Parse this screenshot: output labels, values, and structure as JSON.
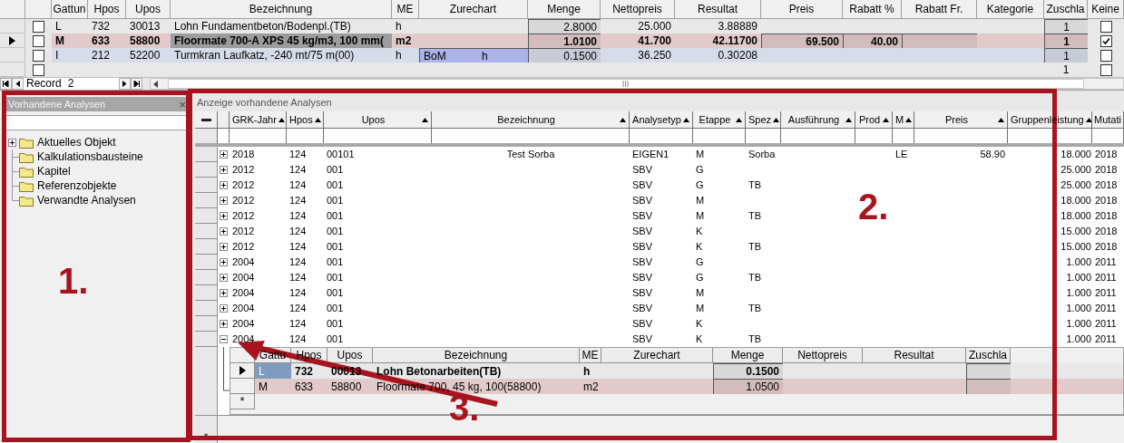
{
  "positions": {
    "columns": [
      {
        "label": "Gattun"
      },
      {
        "label": "Hpos"
      },
      {
        "label": "Upos"
      },
      {
        "label": "Bezeichnung"
      },
      {
        "label": "ME"
      },
      {
        "label": "Zurechart"
      },
      {
        "label": "Menge"
      },
      {
        "label": "Nettopreis"
      },
      {
        "label": "Resultat"
      },
      {
        "label": "Preis"
      },
      {
        "label": "Rabatt %"
      },
      {
        "label": "Rabatt Fr."
      },
      {
        "label": "Kategorie"
      },
      {
        "label": "Zuschla"
      },
      {
        "label": "Keine"
      }
    ],
    "rows": [
      {
        "selected": false,
        "checked": false,
        "keine_checked": false,
        "color": "#e8e8e8",
        "cells": [
          "L",
          "732",
          "30013",
          "Lohn Fundamentbeton/Bodenpl.(TB)",
          "h",
          null,
          "2.8000",
          "25.000",
          "3.88889",
          null,
          null,
          null,
          null,
          "1"
        ]
      },
      {
        "selected": true,
        "checked": false,
        "keine_checked": true,
        "color": "#e2caca",
        "cells": [
          "M",
          "633",
          "58800",
          "Floormate 700-A XPS 45 kg/m3, 100 mm(",
          "m2",
          null,
          "1.0100",
          "41.700",
          "42.11700",
          "69.500",
          "40.00",
          null,
          null,
          "1"
        ]
      },
      {
        "selected": false,
        "checked": false,
        "keine_checked": false,
        "color": "#d6dce8",
        "cells": [
          "I",
          "212",
          "52200",
          "Turmkran Laufkatz, -240 mt/75 m(00)",
          "h",
          "BoM h",
          "0.1500",
          "36.250",
          "0.30208",
          null,
          null,
          null,
          null,
          "1"
        ]
      },
      {
        "selected": false,
        "checked": false,
        "keine_checked": false,
        "color": "#e8e8e8",
        "cells": [
          null,
          null,
          null,
          null,
          null,
          null,
          null,
          null,
          null,
          null,
          null,
          null,
          null,
          "1"
        ]
      }
    ],
    "navigator": {
      "label": "Record",
      "value": "2"
    }
  },
  "left_panel": {
    "title": "Vorhandene Analysen",
    "close": "×",
    "tree": [
      {
        "label": "Aktuelles Objekt",
        "kind": "collapsed"
      },
      {
        "label": "Kalkulationsbausteine",
        "kind": "leaf"
      },
      {
        "label": "Kapitel",
        "kind": "leaf"
      },
      {
        "label": "Referenzobjekte",
        "kind": "leaf"
      },
      {
        "label": "Verwandte Analysen",
        "kind": "leaf"
      }
    ]
  },
  "analyses": {
    "title": "Anzeige vorhandene Analysen",
    "columns": [
      {
        "label": "GRK-Jahr",
        "sorted": true
      },
      {
        "label": "Hpos",
        "sorted": true
      },
      {
        "label": "Upos",
        "sorted": true
      },
      {
        "label": "Bezeichnung",
        "sorted": true
      },
      {
        "label": "Analysetyp",
        "sorted": true
      },
      {
        "label": "Etappe",
        "sorted": true
      },
      {
        "label": "Spez",
        "sorted": true
      },
      {
        "label": "Ausführung",
        "sorted": true
      },
      {
        "label": "Prod",
        "sorted": true
      },
      {
        "label": "M",
        "sorted": true
      },
      {
        "label": "Preis",
        "sorted": true
      },
      {
        "label": "Gruppenleistung",
        "sorted": true
      },
      {
        "label": "Mutati",
        "sorted": false
      }
    ],
    "rows": [
      {
        "expanded": false,
        "cells": [
          "2018",
          "124",
          "00101",
          "Test Sorba",
          "EIGEN1",
          "M",
          "Sorba",
          null,
          null,
          "LE",
          "58.90",
          "18.000",
          "2018"
        ]
      },
      {
        "expanded": false,
        "cells": [
          "2012",
          "124",
          "001",
          null,
          "SBV",
          "G",
          null,
          null,
          null,
          null,
          null,
          "25.000",
          "2018"
        ]
      },
      {
        "expanded": false,
        "cells": [
          "2012",
          "124",
          "001",
          null,
          "SBV",
          "G",
          "TB",
          null,
          null,
          null,
          null,
          "25.000",
          "2018"
        ]
      },
      {
        "expanded": false,
        "cells": [
          "2012",
          "124",
          "001",
          null,
          "SBV",
          "M",
          null,
          null,
          null,
          null,
          null,
          "18.000",
          "2018"
        ]
      },
      {
        "expanded": false,
        "cells": [
          "2012",
          "124",
          "001",
          null,
          "SBV",
          "M",
          "TB",
          null,
          null,
          null,
          null,
          "18.000",
          "2018"
        ]
      },
      {
        "expanded": false,
        "cells": [
          "2012",
          "124",
          "001",
          null,
          "SBV",
          "K",
          null,
          null,
          null,
          null,
          null,
          "15.000",
          "2018"
        ]
      },
      {
        "expanded": false,
        "cells": [
          "2012",
          "124",
          "001",
          null,
          "SBV",
          "K",
          "TB",
          null,
          null,
          null,
          null,
          "15.000",
          "2018"
        ]
      },
      {
        "expanded": false,
        "cells": [
          "2004",
          "124",
          "001",
          null,
          "SBV",
          "G",
          null,
          null,
          null,
          null,
          null,
          "1.000",
          "2011"
        ]
      },
      {
        "expanded": false,
        "cells": [
          "2004",
          "124",
          "001",
          null,
          "SBV",
          "G",
          "TB",
          null,
          null,
          null,
          null,
          "1.000",
          "2011"
        ]
      },
      {
        "expanded": false,
        "cells": [
          "2004",
          "124",
          "001",
          null,
          "SBV",
          "M",
          null,
          null,
          null,
          null,
          null,
          "1.000",
          "2011"
        ]
      },
      {
        "expanded": false,
        "cells": [
          "2004",
          "124",
          "001",
          null,
          "SBV",
          "M",
          "TB",
          null,
          null,
          null,
          null,
          "1.000",
          "2011"
        ]
      },
      {
        "expanded": false,
        "cells": [
          "2004",
          "124",
          "001",
          null,
          "SBV",
          "K",
          null,
          null,
          null,
          null,
          null,
          "1.000",
          "2011"
        ]
      },
      {
        "expanded": true,
        "cells": [
          "2004",
          "124",
          "001",
          null,
          "SBV",
          "K",
          "TB",
          null,
          null,
          null,
          null,
          "1.000",
          "2011"
        ],
        "detail": {
          "columns": [
            {
              "label": "Gattu"
            },
            {
              "label": "Hpos"
            },
            {
              "label": "Upos"
            },
            {
              "label": "Bezeichnung"
            },
            {
              "label": "ME"
            },
            {
              "label": "Zurechart"
            },
            {
              "label": "Menge"
            },
            {
              "label": "Nettopreis"
            },
            {
              "label": "Resultat"
            },
            {
              "label": "Zuschla"
            }
          ],
          "rows": [
            {
              "selected": true,
              "color": "#e8e8e8",
              "cells": [
                "L",
                "732",
                "00013",
                "Lohn Betonarbeiten(TB)",
                "h",
                null,
                "0.1500",
                null,
                null,
                null
              ]
            },
            {
              "selected": false,
              "color": "#e2caca",
              "cells": [
                "M",
                "633",
                "58800",
                "Floormate 700, 45 kg, 100(58800)",
                "m2",
                null,
                "1.0500",
                null,
                null,
                null
              ]
            }
          ],
          "new_row_marker": "*"
        }
      }
    ],
    "new_row_marker": "*"
  },
  "annotations": [
    {
      "kind": "box",
      "label": "1."
    },
    {
      "kind": "box",
      "label": "2."
    },
    {
      "kind": "arrow",
      "label": "3."
    }
  ]
}
